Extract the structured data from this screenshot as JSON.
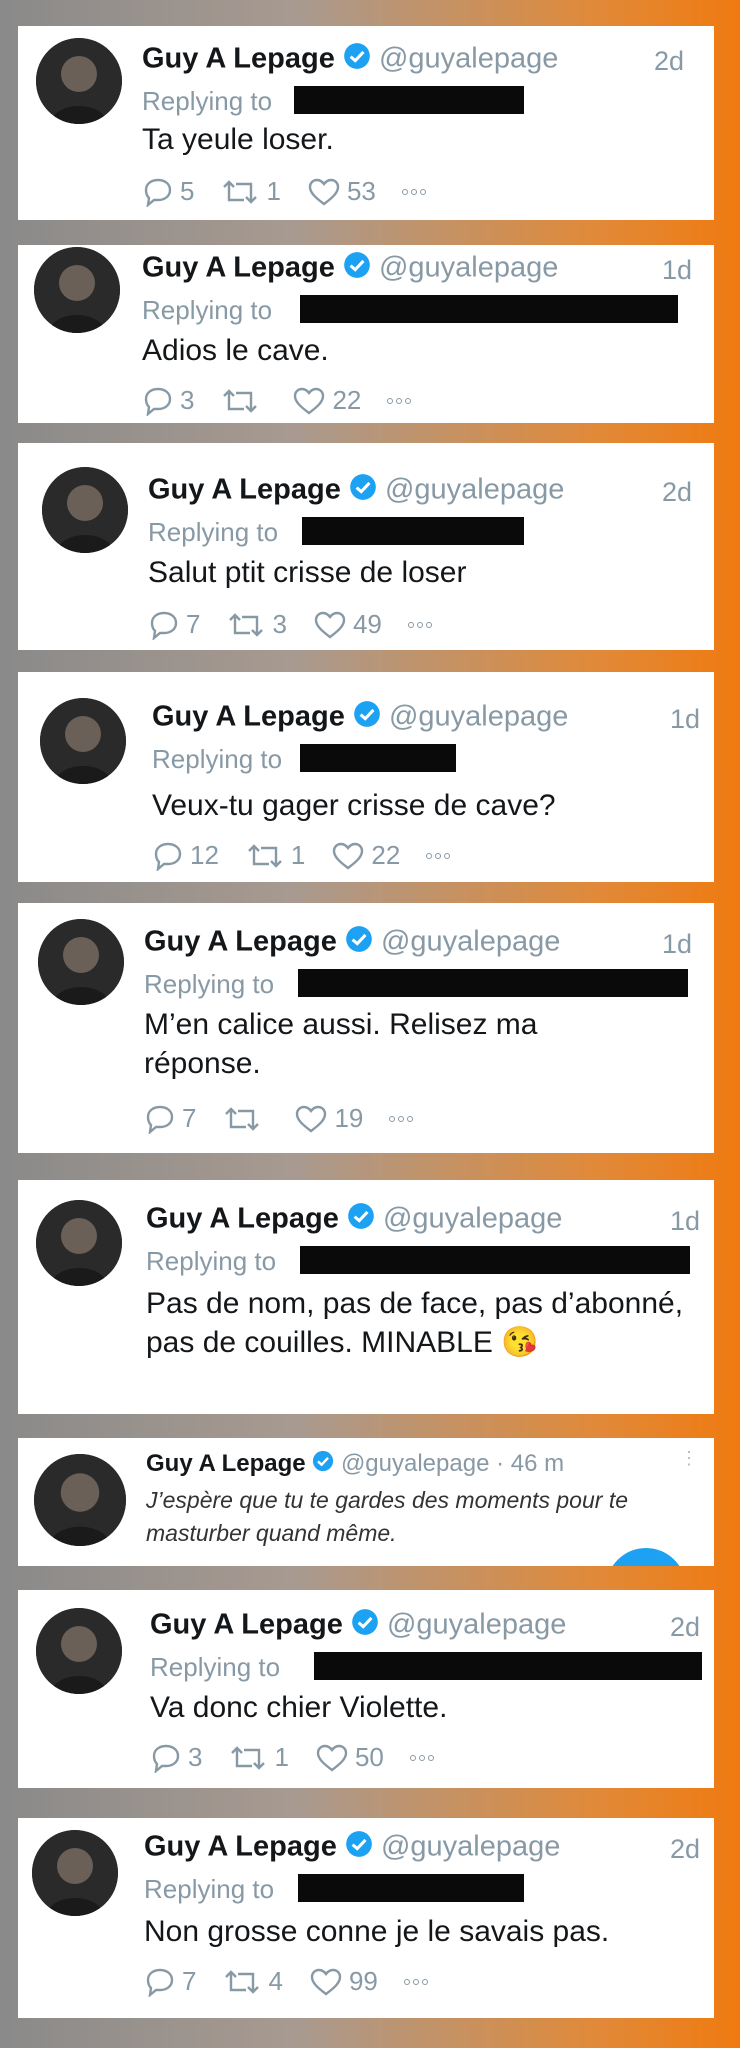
{
  "tweets": [
    {
      "name": "Guy A Lepage",
      "handle": "@guyalepage",
      "time": "2d",
      "reply_label": "Replying to",
      "text": "Ta yeule loser.",
      "replies": "5",
      "retweets": "1",
      "likes": "53"
    },
    {
      "name": "Guy A Lepage",
      "handle": "@guyalepage",
      "time": "1d",
      "reply_label": "Replying to",
      "text": "Adios le cave.",
      "replies": "3",
      "retweets": "",
      "likes": "22"
    },
    {
      "name": "Guy A Lepage",
      "handle": "@guyalepage",
      "time": "2d",
      "reply_label": "Replying to",
      "text": "Salut ptit crisse de loser",
      "replies": "7",
      "retweets": "3",
      "likes": "49"
    },
    {
      "name": "Guy A Lepage",
      "handle": "@guyalepage",
      "time": "1d",
      "reply_label": "Replying to",
      "text": "Veux-tu gager crisse de cave?",
      "replies": "12",
      "retweets": "1",
      "likes": "22"
    },
    {
      "name": "Guy A Lepage",
      "handle": "@guyalepage",
      "time": "1d",
      "reply_label": "Replying to",
      "text": "M’en calice aussi. Relisez ma réponse.",
      "replies": "7",
      "retweets": "",
      "likes": "19"
    },
    {
      "name": "Guy A Lepage",
      "handle": "@guyalepage",
      "time": "1d",
      "reply_label": "Replying to",
      "text": "Pas de nom, pas de face, pas d’abonné, pas de couilles. MINABLE 😘",
      "replies": "",
      "retweets": "",
      "likes": ""
    },
    {
      "name": "Guy A Lepage",
      "handle": "@guyalepage · 46 m",
      "time": "",
      "reply_label": "",
      "text": "J’espère que tu te gardes des moments pour te masturber quand même.",
      "replies": "",
      "retweets": "",
      "likes": ""
    },
    {
      "name": "Guy A Lepage",
      "handle": "@guyalepage",
      "time": "2d",
      "reply_label": "Replying to",
      "text": "Va donc chier Violette.",
      "replies": "3",
      "retweets": "1",
      "likes": "50"
    },
    {
      "name": "Guy A Lepage",
      "handle": "@guyalepage",
      "time": "2d",
      "reply_label": "Replying to",
      "text": "Non grosse conne je le savais pas.",
      "replies": "7",
      "retweets": "4",
      "likes": "99"
    }
  ],
  "icons": {
    "reply": "reply-icon",
    "retweet": "retweet-icon",
    "like": "heart-icon",
    "more": "more-icon",
    "verified": "verified-badge-icon"
  },
  "colors": {
    "verified": "#1da1f2",
    "muted": "#8899a6",
    "text": "#14171a"
  }
}
